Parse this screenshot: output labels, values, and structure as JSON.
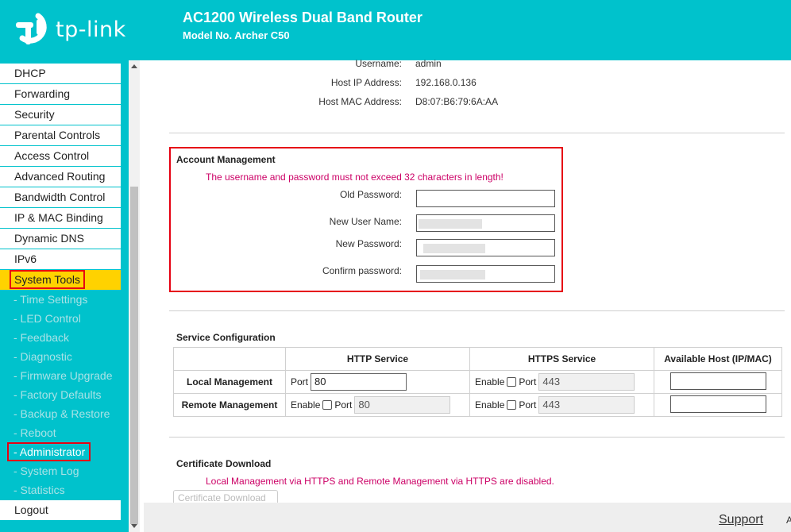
{
  "header": {
    "logo_text": "tp-link",
    "title": "AC1200 Wireless Dual Band Router",
    "model": "Model No. Archer C50"
  },
  "sidebar": {
    "items": [
      {
        "label": "DHCP"
      },
      {
        "label": "Forwarding"
      },
      {
        "label": "Security"
      },
      {
        "label": "Parental Controls"
      },
      {
        "label": "Access Control"
      },
      {
        "label": "Advanced Routing"
      },
      {
        "label": "Bandwidth Control"
      },
      {
        "label": "IP & MAC Binding"
      },
      {
        "label": "Dynamic DNS"
      },
      {
        "label": "IPv6"
      },
      {
        "label": "System Tools"
      }
    ],
    "sub_items": [
      {
        "label": "- Time Settings"
      },
      {
        "label": "- LED Control"
      },
      {
        "label": "- Feedback"
      },
      {
        "label": "- Diagnostic"
      },
      {
        "label": "- Firmware Upgrade"
      },
      {
        "label": "- Factory Defaults"
      },
      {
        "label": "- Backup & Restore"
      },
      {
        "label": "- Reboot"
      },
      {
        "label": "- Administrator"
      },
      {
        "label": "- System Log"
      },
      {
        "label": "- Statistics"
      }
    ],
    "logout": "Logout"
  },
  "info": {
    "username_label": "Username:",
    "username_value": "admin",
    "host_ip_label": "Host IP Address:",
    "host_ip_value": "192.168.0.136",
    "host_mac_label": "Host MAC Address:",
    "host_mac_value": "D8:07:B6:79:6A:AA"
  },
  "account": {
    "title": "Account Management",
    "warning": "The username and password must not exceed 32 characters in length!",
    "old_password_label": "Old Password:",
    "new_username_label": "New User Name:",
    "new_password_label": "New Password:",
    "confirm_password_label": "Confirm password:"
  },
  "service": {
    "title": "Service Configuration",
    "col_http": "HTTP Service",
    "col_https": "HTTPS Service",
    "col_host": "Available Host (IP/MAC)",
    "row_local": "Local Management",
    "row_remote": "Remote Management",
    "port_label": "Port",
    "enable_label": "Enable",
    "local_http_port": "80",
    "local_https_port": "443",
    "remote_http_port": "80",
    "remote_https_port": "443"
  },
  "certificate": {
    "title": "Certificate Download",
    "warning": "Local Management via HTTPS and Remote Management via HTTPS are disabled.",
    "button": "Certificate Download"
  },
  "footer": {
    "support": "Support",
    "cut_text": "A"
  },
  "colors": {
    "brand": "#00c2cc",
    "active_menu": "#ffd200",
    "highlight_box": "#e60012",
    "warning_text": "#cc0066"
  }
}
